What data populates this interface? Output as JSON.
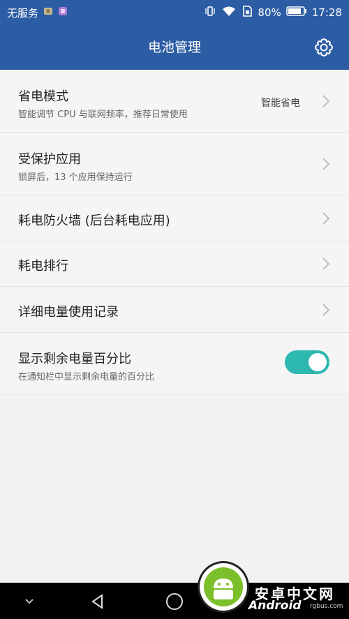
{
  "status_bar": {
    "carrier": "无服务",
    "battery_percent": "80%",
    "time": "17:28",
    "icons": [
      "photo-notification-icon",
      "app-notification-icon",
      "vibrate-icon",
      "wifi-icon",
      "sim-icon",
      "battery-icon"
    ]
  },
  "app_bar": {
    "title": "电池管理",
    "settings_icon": "gear-icon"
  },
  "rows": [
    {
      "title": "省电模式",
      "subtitle": "智能调节 CPU 与联网频率，推荐日常使用",
      "value": "智能省电"
    },
    {
      "title": "受保护应用",
      "subtitle": "锁屏后，13 个应用保持运行"
    },
    {
      "title": "耗电防火墙 (后台耗电应用)"
    },
    {
      "title": "耗电排行"
    },
    {
      "title": "详细电量使用记录"
    },
    {
      "title": "显示剩余电量百分比",
      "subtitle": "在通知栏中显示剩余电量的百分比",
      "toggle_on": true
    }
  ],
  "watermark": {
    "cn": "安卓中文网",
    "en": "Android",
    "url": "rgbus.com"
  },
  "colors": {
    "primary": "#2c5ca3",
    "toggle": "#2db8b0",
    "background": "#f2f2f2"
  },
  "nav_icons": [
    "chevron-down-icon",
    "back-icon",
    "home-icon"
  ]
}
